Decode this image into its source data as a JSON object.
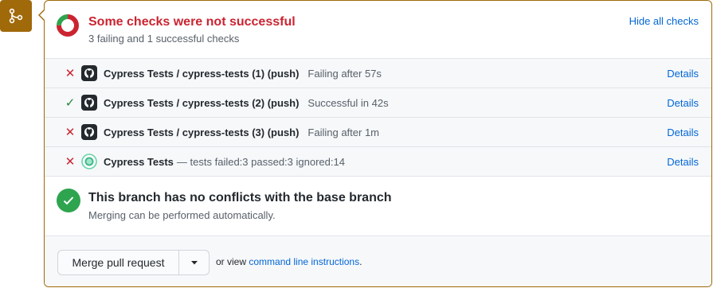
{
  "status": {
    "title": "Some checks were not successful",
    "subtitle": "3 failing and 1 successful checks",
    "hide_link": "Hide all checks",
    "failing_count": 3,
    "successful_count": 1,
    "colors": {
      "fail": "#cb2431",
      "pass": "#2ea44f",
      "link": "#0366d6",
      "badge": "#a0690a"
    }
  },
  "checks": [
    {
      "status_icon": "x-icon",
      "status_glyph": "✕",
      "app_icon": "github-icon",
      "name": "Cypress Tests / cypress-tests (1) (push)",
      "description": "Failing after 57s",
      "details_label": "Details"
    },
    {
      "status_icon": "check-icon",
      "status_glyph": "✓",
      "app_icon": "github-icon",
      "name": "Cypress Tests / cypress-tests (2) (push)",
      "description": "Successful in 42s",
      "details_label": "Details"
    },
    {
      "status_icon": "x-icon",
      "status_glyph": "✕",
      "app_icon": "github-icon",
      "name": "Cypress Tests / cypress-tests (3) (push)",
      "description": "Failing after 1m",
      "details_label": "Details"
    },
    {
      "status_icon": "x-icon",
      "status_glyph": "✕",
      "app_icon": "cypress-icon",
      "name": "Cypress Tests",
      "description": "— tests failed:3 passed:3 ignored:14",
      "details_label": "Details"
    }
  ],
  "conflicts": {
    "title": "This branch has no conflicts with the base branch",
    "subtitle": "Merging can be performed automatically."
  },
  "merge": {
    "button_label": "Merge pull request",
    "hint_prefix": "or view",
    "hint_link": "command line instructions",
    "hint_suffix": "."
  }
}
